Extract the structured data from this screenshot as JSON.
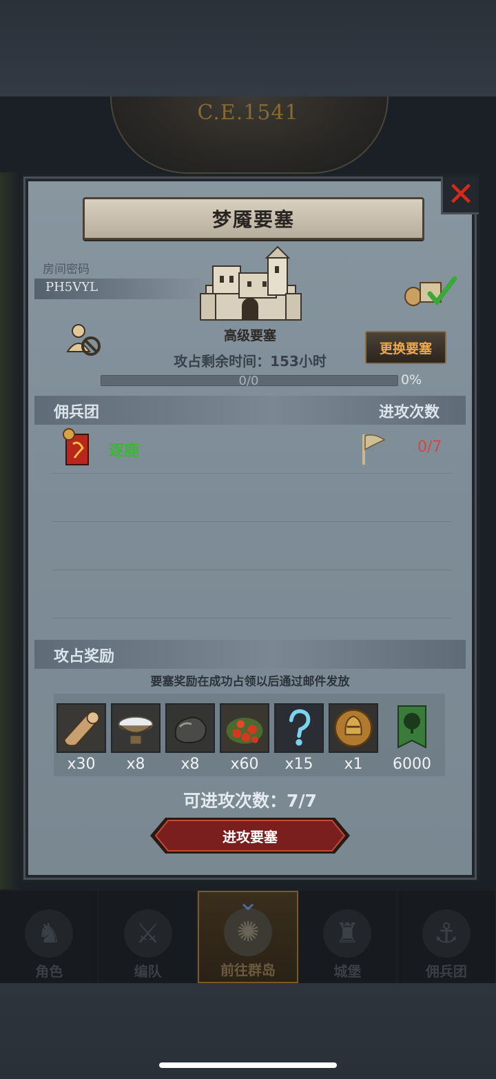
{
  "era": "C.E.1541",
  "dialog": {
    "title": "梦魇要塞",
    "close_icon": "close-icon",
    "room_label": "房间密码",
    "room_code": "PH5VYL",
    "fort_level": "高级要塞",
    "change_button": "更换要塞",
    "remaining_prefix": "攻占剩余时间：",
    "remaining_value": "153小时",
    "progress_text": "0/0",
    "progress_percent": "0%",
    "progress_fraction": 0,
    "mercenary_header": "佣兵团",
    "attack_count_header": "进攻次数",
    "mercenaries": [
      {
        "name": "逐鹿",
        "count": "0/7"
      }
    ],
    "reward_header": "攻占奖励",
    "reward_note": "要塞奖励在成功占领以后通过邮件发放",
    "rewards": [
      {
        "icon": "wood-log-icon",
        "qty": "x30"
      },
      {
        "icon": "salt-bowl-icon",
        "qty": "x8"
      },
      {
        "icon": "stone-ore-icon",
        "qty": "x8"
      },
      {
        "icon": "berries-icon",
        "qty": "x60"
      },
      {
        "icon": "mystery-question-icon",
        "qty": "x15"
      },
      {
        "icon": "knight-helmet-coin-icon",
        "qty": "x1"
      },
      {
        "icon": "green-tree-banner-icon",
        "qty": "6000"
      }
    ],
    "attempts_label": "可进攻次数：7/7",
    "attack_button": "进攻要塞"
  },
  "nav": [
    {
      "label": "角色",
      "icon": "character-icon"
    },
    {
      "label": "编队",
      "icon": "formation-icon"
    },
    {
      "label": "前往群岛",
      "icon": "islands-map-icon"
    },
    {
      "label": "城堡",
      "icon": "castle-icon"
    },
    {
      "label": "佣兵团",
      "icon": "mercenary-ship-icon"
    }
  ],
  "colors": {
    "merc_name": "#3fb33a",
    "merc_count": "#d04a42",
    "change_text": "#f2a848",
    "close": "#d42a1a",
    "attack_button": "#7a1e1e"
  }
}
